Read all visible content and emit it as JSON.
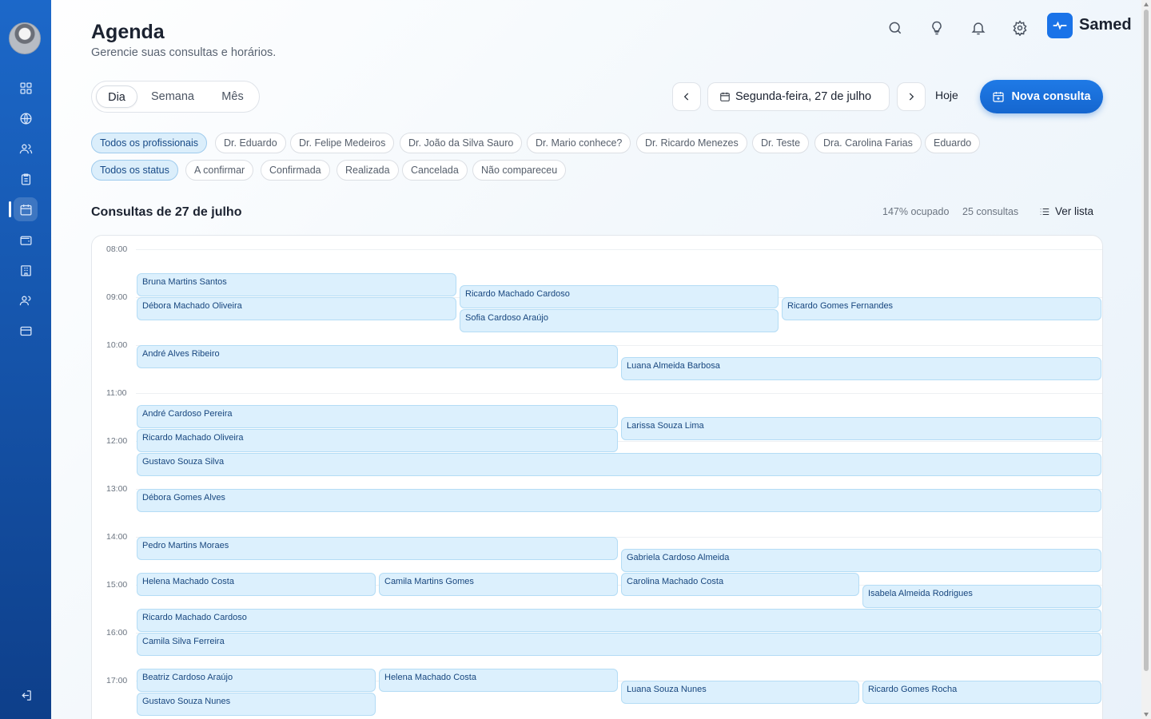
{
  "header": {
    "title": "Agenda",
    "subtitle": "Gerencie suas consultas e horários.",
    "brand": "Samed"
  },
  "icons": {
    "sidebar": [
      "dashboard-icon",
      "globe-icon",
      "users-icon",
      "clipboard-icon",
      "calendar-icon",
      "wallet-icon",
      "building-icon",
      "team-icon",
      "card-icon",
      "logout-icon"
    ],
    "top": [
      "search-icon",
      "lightbulb-icon",
      "bell-icon",
      "gear-icon"
    ]
  },
  "view_tabs": [
    "Dia",
    "Semana",
    "Mês"
  ],
  "active_view": "Dia",
  "date_nav": {
    "date_label": "Segunda-feira, 27 de julho",
    "today_label": "Hoje",
    "new_label": "Nova consulta"
  },
  "professional_filters": [
    "Todos os profissionais",
    "Dr. Eduardo",
    "Dr. Felipe Medeiros",
    "Dr. João da Silva Sauro",
    "Dr. Mario conhece?",
    "Dr. Ricardo Menezes",
    "Dr. Teste",
    "Dra. Carolina Farias",
    "Eduardo"
  ],
  "status_filters": [
    "Todos os status",
    "A confirmar",
    "Confirmada",
    "Realizada",
    "Cancelada",
    "Não compareceu"
  ],
  "section": {
    "title": "Consultas de 27 de julho",
    "occupancy": "147% ocupado",
    "count": "25 consultas",
    "list_label": "Ver lista"
  },
  "hours": [
    "08:00",
    "09:00",
    "10:00",
    "11:00",
    "12:00",
    "13:00",
    "14:00",
    "15:00",
    "16:00",
    "17:00"
  ],
  "appointments": [
    {
      "patient": "Bruna Martins Santos"
    },
    {
      "patient": "Débora Machado Oliveira"
    },
    {
      "patient": "Ricardo Machado Cardoso"
    },
    {
      "patient": "Sofia Cardoso Araújo"
    },
    {
      "patient": "Ricardo Gomes Fernandes"
    },
    {
      "patient": "André Alves Ribeiro"
    },
    {
      "patient": "Luana Almeida Barbosa"
    },
    {
      "patient": "André Cardoso Pereira"
    },
    {
      "patient": "Larissa Souza Lima"
    },
    {
      "patient": "Ricardo Machado Oliveira"
    },
    {
      "patient": "Gustavo Souza Silva"
    },
    {
      "patient": "Débora Gomes Alves"
    },
    {
      "patient": "Pedro Martins Moraes"
    },
    {
      "patient": "Gabriela Cardoso Almeida"
    },
    {
      "patient": "Helena Machado Costa"
    },
    {
      "patient": "Camila Martins Gomes"
    },
    {
      "patient": "Carolina Machado Costa"
    },
    {
      "patient": "Isabela Almeida Rodrigues"
    },
    {
      "patient": "Ricardo Machado Cardoso"
    },
    {
      "patient": "Camila Silva Ferreira"
    },
    {
      "patient": "Beatriz Cardoso Araújo"
    },
    {
      "patient": "Helena Machado Costa"
    },
    {
      "patient": "Luana Souza Nunes"
    },
    {
      "patient": "Ricardo Gomes Rocha"
    },
    {
      "patient": "Gustavo Souza Nunes"
    }
  ],
  "colors": {
    "sidebar_top": "#1c68c9",
    "sidebar_bottom": "#0e3f8a",
    "primary": "#1a73e8",
    "chip_active_bg": "#dbeefb",
    "appointment_bg": "#dcf0fd",
    "appointment_border": "#b4dcf5",
    "appointment_text": "#17467e"
  }
}
